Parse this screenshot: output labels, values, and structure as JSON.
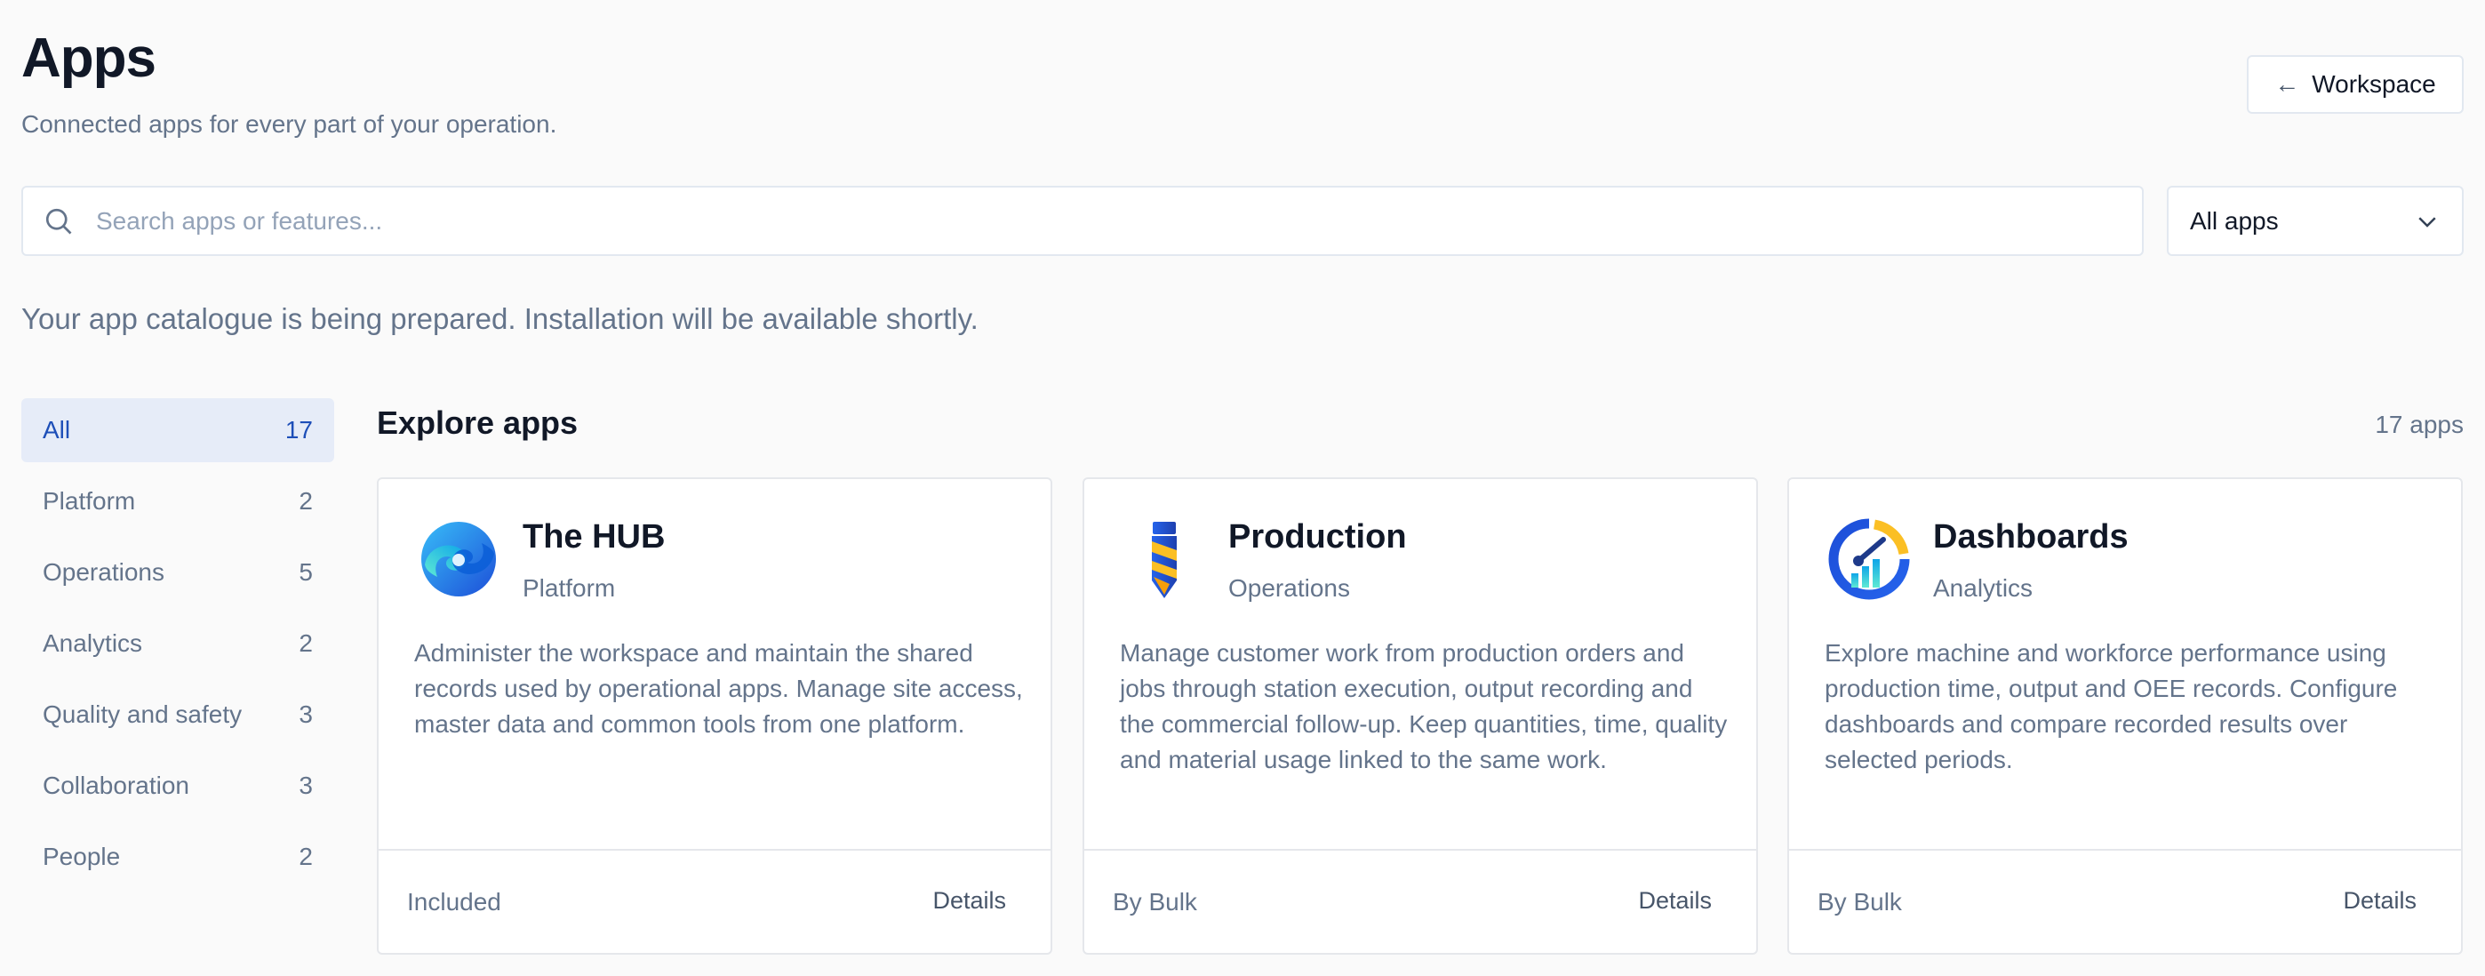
{
  "header": {
    "title": "Apps",
    "subtitle": "Connected apps for every part of your operation.",
    "back_label": "Workspace"
  },
  "search": {
    "placeholder": "Search apps or features...",
    "value": ""
  },
  "filter": {
    "selected": "All apps"
  },
  "notice": "Your app catalogue is being prepared. Installation will be available shortly.",
  "sidebar": {
    "items": [
      {
        "label": "All",
        "count": "17",
        "active": true
      },
      {
        "label": "Platform",
        "count": "2"
      },
      {
        "label": "Operations",
        "count": "5"
      },
      {
        "label": "Analytics",
        "count": "2"
      },
      {
        "label": "Quality and safety",
        "count": "3"
      },
      {
        "label": "Collaboration",
        "count": "3"
      },
      {
        "label": "People",
        "count": "2"
      }
    ]
  },
  "main": {
    "title": "Explore apps",
    "count": "17 apps",
    "cards": [
      {
        "name": "The HUB",
        "category": "Platform",
        "description": "Administer the workspace and maintain the shared records used by operational apps. Manage site access, master data and common tools from one platform.",
        "meta": "Included",
        "details_label": "Details",
        "icon": "hub-logo-icon"
      },
      {
        "name": "Production",
        "category": "Operations",
        "description": "Manage customer work from production orders and jobs through station execution, output recording and the commercial follow-up. Keep quantities, time, quality and material usage linked to the same work.",
        "meta": "By Bulk",
        "details_label": "Details",
        "icon": "drill-bit-icon"
      },
      {
        "name": "Dashboards",
        "category": "Analytics",
        "description": "Explore machine and workforce performance using production time, output and OEE records. Configure dashboards and compare recorded results over selected periods.",
        "meta": "By Bulk",
        "details_label": "Details",
        "icon": "gauge-chart-icon"
      }
    ]
  },
  "colors": {
    "background": "#fafafa",
    "active_category_bg": "#e6ecf8",
    "active_category_text": "#1e4fb8",
    "muted_text": "#64748b"
  }
}
